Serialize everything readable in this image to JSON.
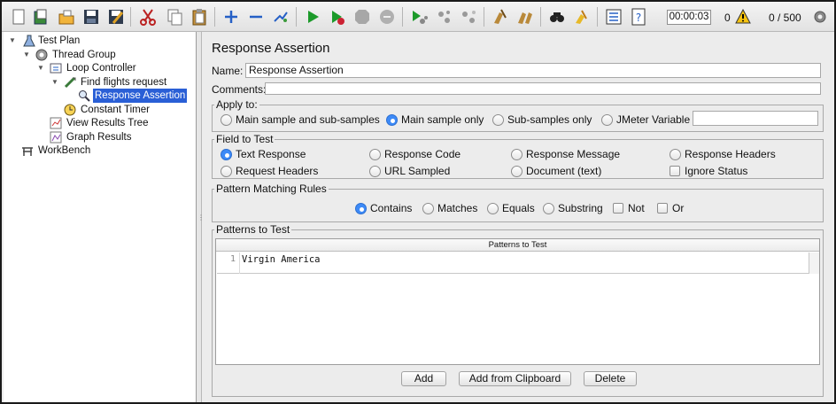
{
  "toolbar": {
    "timer": "00:00:03",
    "error_count": "0",
    "thread_count": "0 / 500",
    "icons": [
      "new-icon",
      "templates-icon",
      "open-icon",
      "save-icon",
      "save-as-icon",
      "cut-icon",
      "copy-icon",
      "paste-icon",
      "expand-icon",
      "collapse-icon",
      "toggle-icon",
      "start-icon",
      "start-no-pause-icon",
      "stop-icon",
      "shutdown-icon",
      "remote-start-icon",
      "remote-stop-icon",
      "remote-exit-icon",
      "clear-icon",
      "clear-all-icon",
      "search-icon",
      "reset-search-icon",
      "function-helper-icon",
      "help-icon"
    ],
    "accent": "#2a5fd6"
  },
  "tree": {
    "items": [
      {
        "label": "Test Plan",
        "icon": "test-plan-icon"
      },
      {
        "label": "Thread Group",
        "icon": "gear-icon"
      },
      {
        "label": "Loop Controller",
        "icon": "controller-icon"
      },
      {
        "label": "Find flights request",
        "icon": "sampler-icon"
      },
      {
        "label": "Response Assertion",
        "icon": "magnifier-icon",
        "selected": true
      },
      {
        "label": "Constant Timer",
        "icon": "timer-icon"
      },
      {
        "label": "View Results Tree",
        "icon": "listener-icon"
      },
      {
        "label": "Graph Results",
        "icon": "graph-icon"
      },
      {
        "label": "WorkBench",
        "icon": "workbench-icon"
      }
    ]
  },
  "main": {
    "title": "Response Assertion",
    "name_label": "Name:",
    "name_value": "Response Assertion",
    "comments_label": "Comments:",
    "apply_to": {
      "legend": "Apply to:",
      "options": [
        "Main sample and sub-samples",
        "Main sample only",
        "Sub-samples only",
        "JMeter Variable"
      ],
      "selected": "Main sample only"
    },
    "field_to_test": {
      "legend": "Field to Test",
      "options": [
        "Text Response",
        "Response Code",
        "Response Message",
        "Response Headers",
        "Request Headers",
        "URL Sampled",
        "Document (text)"
      ],
      "ignore_status": "Ignore Status",
      "selected": "Text Response"
    },
    "pattern_rules": {
      "legend": "Pattern Matching Rules",
      "options": [
        "Contains",
        "Matches",
        "Equals",
        "Substring"
      ],
      "not_label": "Not",
      "or_label": "Or",
      "selected": "Contains"
    },
    "patterns": {
      "legend": "Patterns to Test",
      "column_header": "Patterns to Test",
      "rows": [
        {
          "line": "1",
          "value": "Virgin America"
        }
      ]
    },
    "buttons": {
      "add": "Add",
      "add_clipboard": "Add from Clipboard",
      "delete": "Delete"
    }
  }
}
